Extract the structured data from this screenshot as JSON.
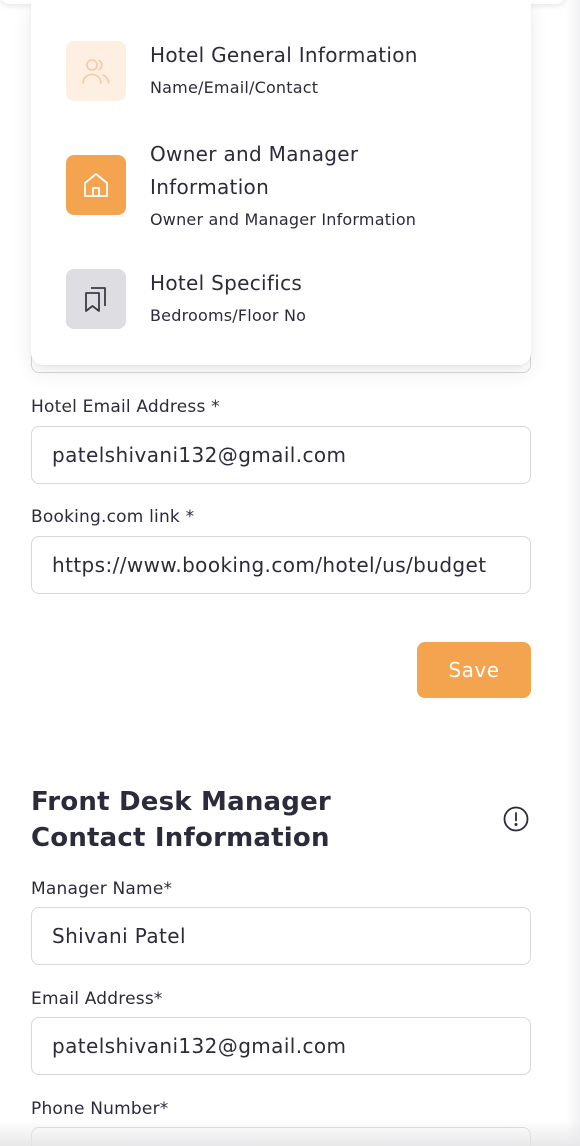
{
  "stepper": {
    "steps": [
      {
        "title": "Hotel General Information",
        "subtitle": "Name/Email/Contact",
        "icon": "users-icon"
      },
      {
        "title_line1": "Owner and Manager",
        "title_line2": "Information",
        "subtitle": "Owner and Manager Information",
        "icon": "home-icon"
      },
      {
        "title": "Hotel Specifics",
        "subtitle": "Bedrooms/Floor No",
        "icon": "bookmarks-icon"
      }
    ]
  },
  "hotel_form": {
    "email_label": "Hotel Email Address *",
    "email_value": "patelshivani132@gmail.com",
    "booking_label": "Booking.com link *",
    "booking_value": "https://www.booking.com/hotel/us/budget",
    "save_label": "Save"
  },
  "front_desk": {
    "title": "Front Desk Manager Contact Information",
    "manager_name_label": "Manager Name*",
    "manager_name_value": "Shivani Patel",
    "email_label": "Email Address*",
    "email_value": "patelshivani132@gmail.com",
    "phone_label": "Phone Number*"
  },
  "colors": {
    "accent": "#f4a44f",
    "accent_pale": "#fdf0e3",
    "inactive_icon_bg": "#dddde2",
    "text": "#2b2b3b",
    "border": "#d7d7dc"
  }
}
